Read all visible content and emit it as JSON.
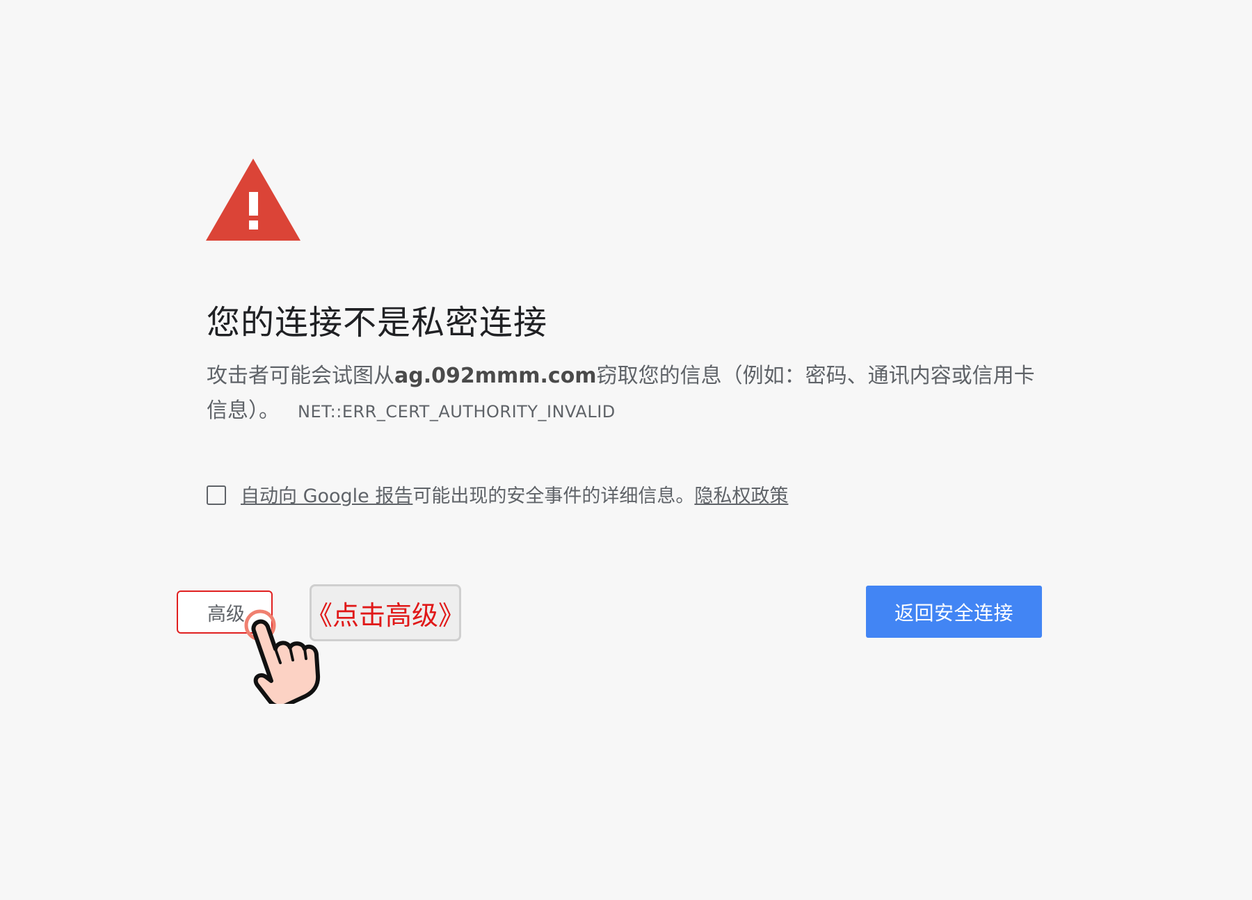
{
  "heading": "您的连接不是私密连接",
  "description": {
    "prefix": "攻击者可能会试图从",
    "domain": "ag.092mmm.com",
    "suffix": "窃取您的信息（例如：密码、通讯内容或信用卡信息）。",
    "error_code": "NET::ERR_CERT_AUTHORITY_INVALID"
  },
  "report": {
    "checked": false,
    "link_text": "自动向 Google 报告",
    "middle_text": "可能出现的安全事件的详细信息。",
    "privacy_link": "隐私权政策"
  },
  "buttons": {
    "advanced": "高级",
    "back": "返回安全连接"
  },
  "callout": {
    "text": "《点击高级》"
  },
  "icons": {
    "warning": "warning-triangle-icon",
    "pointer": "hand-pointer-icon"
  },
  "colors": {
    "warning_red": "#db4437",
    "primary_blue": "#4285f4",
    "annotation_red": "#e01818",
    "background": "#f7f7f7"
  }
}
